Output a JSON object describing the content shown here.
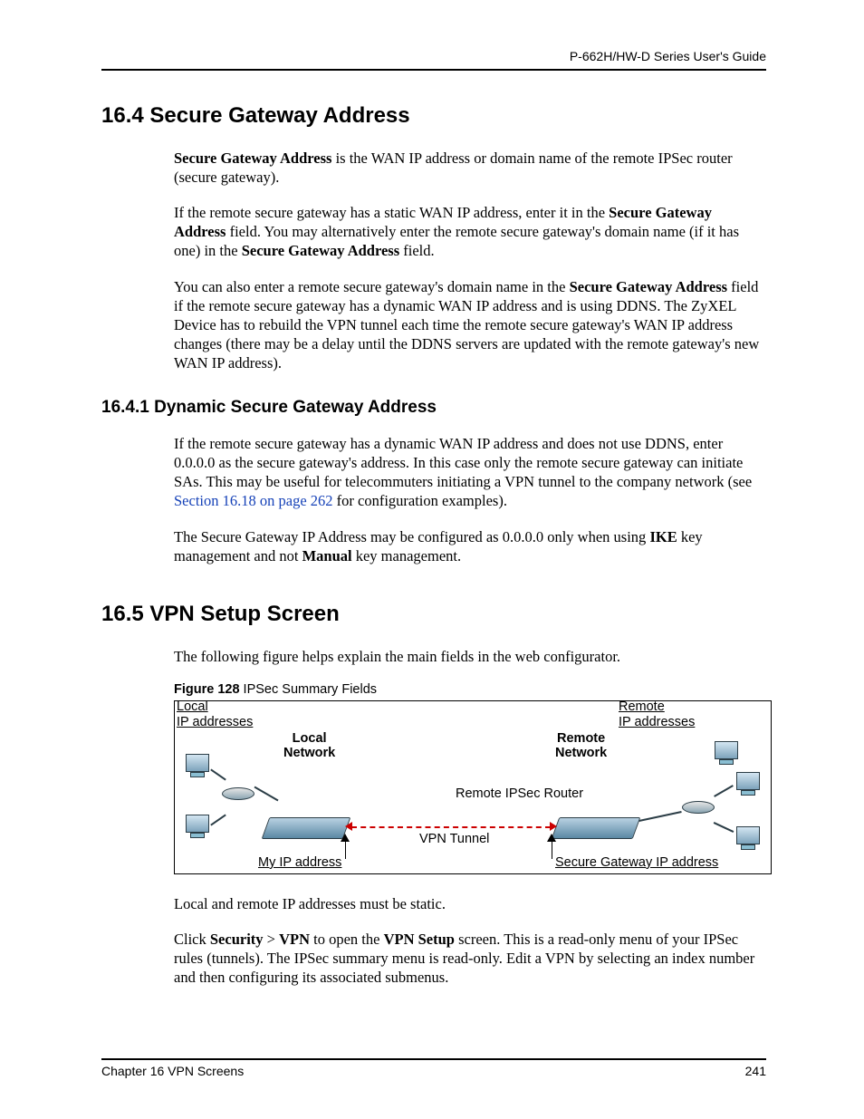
{
  "running_header": "P-662H/HW-D Series User's Guide",
  "sections": {
    "s164": {
      "title": "16.4  Secure Gateway Address",
      "p1a": "Secure Gateway Address",
      "p1b": " is the WAN IP address or domain name of the remote IPSec router (secure gateway).",
      "p2a": "If the remote secure gateway has a static WAN IP address, enter it in the ",
      "p2b": "Secure Gateway Address",
      "p2c": " field. You may alternatively enter the remote secure gateway's domain name (if it has one) in the ",
      "p2d": "Secure Gateway Address",
      "p2e": " field.",
      "p3a": "You can also enter a remote secure gateway's domain name in the ",
      "p3b": "Secure Gateway Address",
      "p3c": " field if the remote secure gateway has a dynamic WAN IP address and is using DDNS. The ZyXEL Device has to rebuild the VPN tunnel each time the remote secure gateway's WAN IP address changes (there may be a delay until the DDNS servers are updated with the remote gateway's new WAN IP address)."
    },
    "s1641": {
      "title": "16.4.1  Dynamic Secure Gateway Address",
      "p1a": "If the remote secure gateway has a dynamic WAN IP address and does not use DDNS, enter 0.0.0.0 as the secure gateway's address. In this case only the remote secure gateway can initiate SAs. This may be useful for telecommuters initiating a VPN tunnel to the company network (see ",
      "p1link": "Section 16.18 on page 262",
      "p1b": " for configuration examples).",
      "p2a": "The Secure Gateway IP Address may be configured as 0.0.0.0 only when using ",
      "p2b": "IKE",
      "p2c": " key management and not ",
      "p2d": "Manual",
      "p2e": " key management."
    },
    "s165": {
      "title": "16.5  VPN Setup Screen",
      "p1": "The following figure helps explain the main fields in the web configurator.",
      "fig_num": "Figure 128",
      "fig_title": "   IPSec Summary Fields",
      "p2": "Local and remote IP addresses must be static.",
      "p3a": "Click ",
      "p3b": "Security",
      "p3c": " > ",
      "p3d": "VPN",
      "p3e": " to open the ",
      "p3f": "VPN Setup",
      "p3g": " screen. This is a read-only menu of your IPSec rules (tunnels). The IPSec summary menu is read-only. Edit a VPN by selecting an index number and then configuring its associated submenus."
    }
  },
  "figure": {
    "local_ip": "Local\nIP addresses",
    "remote_ip": "Remote\nIP addresses",
    "local_net": "Local\nNetwork",
    "remote_net": "Remote\nNetwork",
    "remote_router": "Remote IPSec Router",
    "vpn_tunnel": "VPN Tunnel",
    "my_ip": "My IP address",
    "secure_gw": "Secure Gateway IP address"
  },
  "footer": {
    "left": "Chapter 16 VPN Screens",
    "right": "241"
  }
}
